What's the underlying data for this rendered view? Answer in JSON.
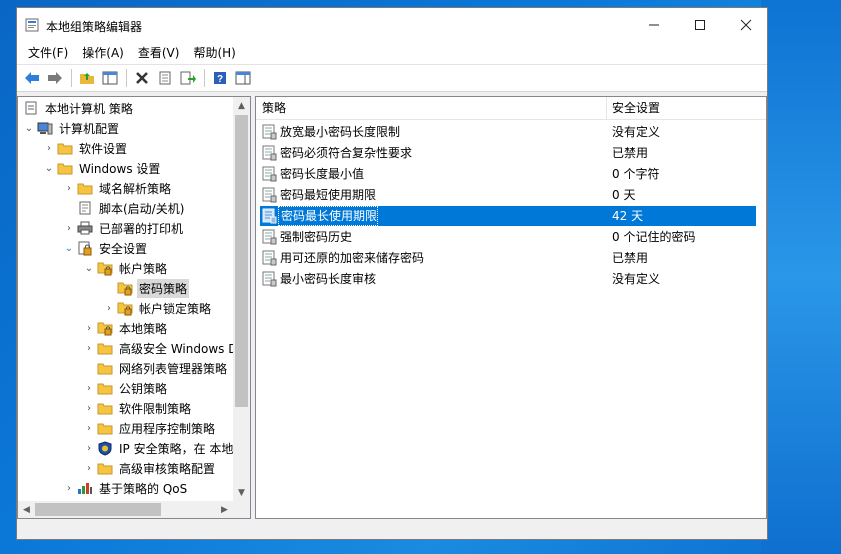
{
  "window": {
    "title": "本地组策略编辑器"
  },
  "menu": {
    "file": "文件(F)",
    "action": "操作(A)",
    "view": "查看(V)",
    "help": "帮助(H)"
  },
  "tree": {
    "root": "本地计算机 策略",
    "computer_config": "计算机配置",
    "software_settings": "软件设置",
    "windows_settings": "Windows 设置",
    "dns": "域名解析策略",
    "scripts": "脚本(启动/关机)",
    "printers": "已部署的打印机",
    "security_settings": "安全设置",
    "account_policies": "帐户策略",
    "password_policy": "密码策略",
    "lockout_policy": "帐户锁定策略",
    "local_policies": "本地策略",
    "firewall": "高级安全 Windows D",
    "network_list": "网络列表管理器策略",
    "public_key": "公钥策略",
    "software_restriction": "软件限制策略",
    "app_control": "应用程序控制策略",
    "ipsec": "IP 安全策略，在 本地",
    "audit": "高级审核策略配置",
    "qos": "基于策略的 QoS"
  },
  "list": {
    "col_policy": "策略",
    "col_setting": "安全设置",
    "rows": [
      {
        "name": "放宽最小密码长度限制",
        "value": "没有定义"
      },
      {
        "name": "密码必须符合复杂性要求",
        "value": "已禁用"
      },
      {
        "name": "密码长度最小值",
        "value": "0 个字符"
      },
      {
        "name": "密码最短使用期限",
        "value": "0 天"
      },
      {
        "name": "密码最长使用期限",
        "value": "42 天"
      },
      {
        "name": "强制密码历史",
        "value": "0 个记住的密码"
      },
      {
        "name": "用可还原的加密来储存密码",
        "value": "已禁用"
      },
      {
        "name": "最小密码长度审核",
        "value": "没有定义"
      }
    ]
  },
  "colors": {
    "selection": "#0078d7",
    "folder": "#f5c542",
    "desktop": "#0b78d8"
  }
}
